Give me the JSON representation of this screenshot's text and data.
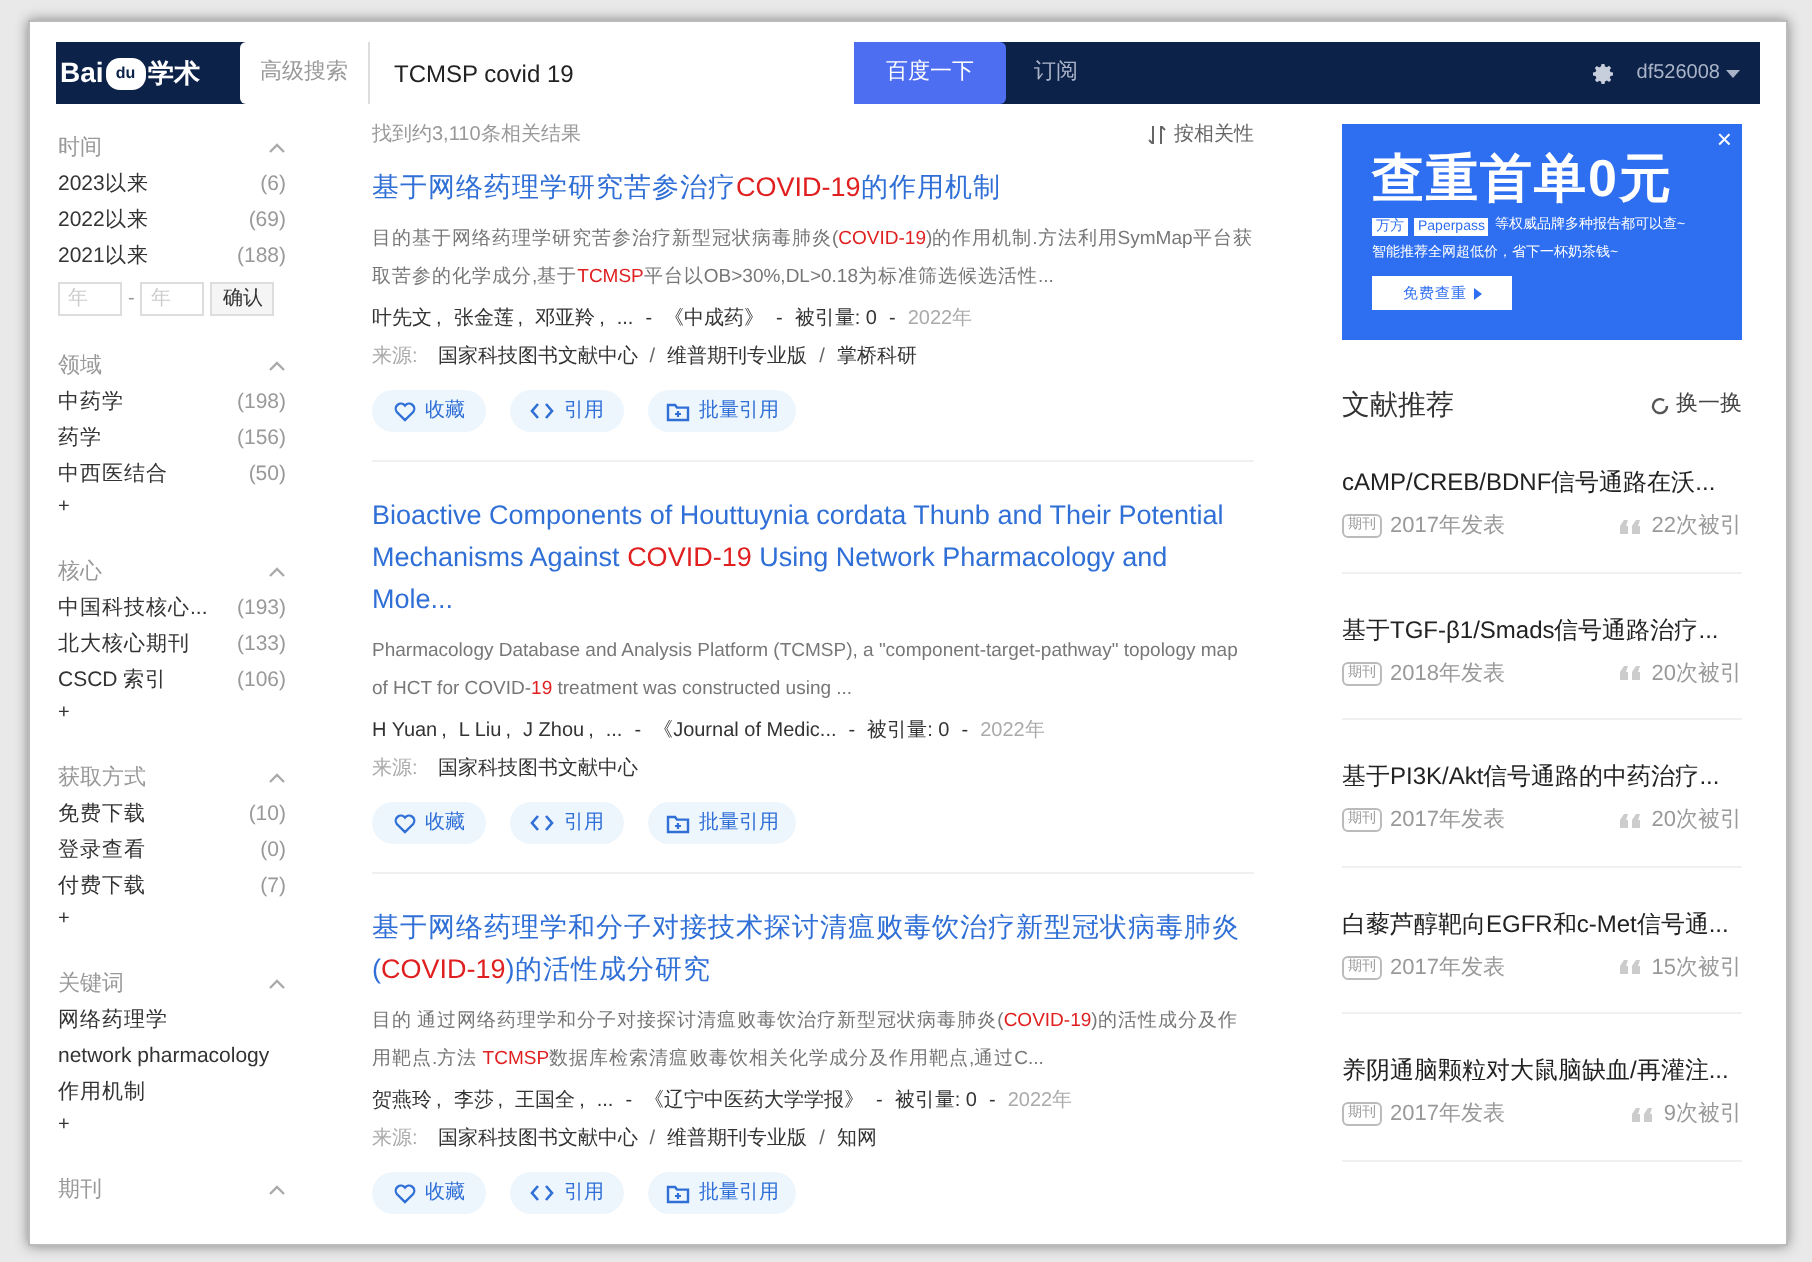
{
  "header": {
    "logo": {
      "left": "Bai",
      "mark": "du",
      "right": "学术"
    },
    "advanced_search": "高级搜索",
    "query": "TCMSP covid 19",
    "search_button": "百度一下",
    "subscribe": "订阅",
    "username": "df526008"
  },
  "sidebar": [
    {
      "title": "时间",
      "expanded": true,
      "items": [
        {
          "label": "2023以来",
          "count": "(6)"
        },
        {
          "label": "2022以来",
          "count": "(69)"
        },
        {
          "label": "2021以来",
          "count": "(188)"
        }
      ],
      "year_range": {
        "from_placeholder": "年",
        "separator": "-",
        "to_placeholder": "年",
        "confirm": "确认"
      }
    },
    {
      "title": "领域",
      "expanded": true,
      "items": [
        {
          "label": "中药学",
          "count": "(198)"
        },
        {
          "label": "药学",
          "count": "(156)"
        },
        {
          "label": "中西医结合",
          "count": "(50)"
        }
      ],
      "more": "+"
    },
    {
      "title": "核心",
      "expanded": true,
      "items": [
        {
          "label": "中国科技核心...",
          "count": "(193)"
        },
        {
          "label": "北大核心期刊",
          "count": "(133)"
        },
        {
          "label": "CSCD 索引",
          "count": "(106)"
        }
      ],
      "more": "+"
    },
    {
      "title": "获取方式",
      "expanded": true,
      "items": [
        {
          "label": "免费下载",
          "count": "(10)"
        },
        {
          "label": "登录查看",
          "count": "(0)"
        },
        {
          "label": "付费下载",
          "count": "(7)"
        }
      ],
      "more": "+"
    },
    {
      "title": "关键词",
      "expanded": true,
      "items": [
        {
          "label": "网络药理学"
        },
        {
          "label": "network pharmacology"
        },
        {
          "label": "作用机制"
        }
      ],
      "more": "+"
    },
    {
      "title": "期刊",
      "expanded": true
    }
  ],
  "results_summary": "找到约3,110条相关结果",
  "sort": "按相关性",
  "results": [
    {
      "title": [
        {
          "text": "基于网络药理学研究苦参治疗",
          "highlight": false
        },
        {
          "text": "COVID-19",
          "highlight": true
        },
        {
          "text": "的作用机制",
          "highlight": false
        }
      ],
      "snippet": [
        {
          "text": "目的基于网络药理学研究苦参治疗新型冠状病毒肺炎(",
          "highlight": false
        },
        {
          "text": "COVID-19",
          "highlight": true
        },
        {
          "text": ")的作用机制.方法利用SymMap平台获取苦参的化学成分,基于",
          "highlight": false
        },
        {
          "text": "TCMSP",
          "highlight": true
        },
        {
          "text": "平台以OB>30%,DL>0.18为标准筛选候选活性...",
          "highlight": false
        }
      ],
      "authors": [
        "叶先文",
        "张金莲",
        "邓亚羚"
      ],
      "author_sep": ",",
      "dash": "-",
      "source_sep": "/",
      "ellipsis": "...",
      "journal": "《中成药》",
      "cited": "被引量: 0",
      "year": "2022年",
      "source_label": "来源:",
      "sources": [
        "国家科技图书文献中心",
        "维普期刊专业版",
        "掌桥科研"
      ],
      "actions": [
        "收藏",
        "引用",
        "批量引用"
      ]
    },
    {
      "title": [
        {
          "text": "Bioactive Components of Houttuynia cordata Thunb and Their Potential Mechanisms Against ",
          "highlight": false
        },
        {
          "text": "COVID-19",
          "highlight": true
        },
        {
          "text": " Using Network Pharmacology and Mole...",
          "highlight": false
        }
      ],
      "snippet": [
        {
          "text": "Pharmacology Database and Analysis Platform (TCMSP), a \"component-target-pathway\" topology map of HCT for COVID-",
          "highlight": false
        },
        {
          "text": "19",
          "highlight": true
        },
        {
          "text": " treatment was constructed using ...",
          "highlight": false
        }
      ],
      "authors": [
        "H Yuan",
        "L Liu",
        "J Zhou"
      ],
      "author_sep": ",",
      "dash": "-",
      "ellipsis": "...",
      "journal": "《Journal of Medic...",
      "cited": "被引量: 0",
      "year": "2022年",
      "source_label": "来源:",
      "sources": [
        "国家科技图书文献中心"
      ],
      "actions": [
        "收藏",
        "引用",
        "批量引用"
      ]
    },
    {
      "title": [
        {
          "text": "基于网络药理学和分子对接技术探讨清瘟败毒饮治疗新型冠状病毒肺炎(",
          "highlight": false
        },
        {
          "text": "COVID-19",
          "highlight": true
        },
        {
          "text": ")的活性成分研究",
          "highlight": false
        }
      ],
      "snippet": [
        {
          "text": "目的 通过网络药理学和分子对接探讨清瘟败毒饮治疗新型冠状病毒肺炎(",
          "highlight": false
        },
        {
          "text": "COVID-19",
          "highlight": true
        },
        {
          "text": ")的活性成分及作用靶点.方法 ",
          "highlight": false
        },
        {
          "text": "TCMSP",
          "highlight": true
        },
        {
          "text": "数据库检索清瘟败毒饮相关化学成分及作用靶点,通过C...",
          "highlight": false
        }
      ],
      "authors": [
        "贺燕玲",
        "李莎",
        "王国全"
      ],
      "author_sep": ",",
      "dash": "-",
      "source_sep": "/",
      "ellipsis": "...",
      "journal": "《辽宁中医药大学学报》",
      "cited": "被引量: 0",
      "year": "2022年",
      "source_label": "来源:",
      "sources": [
        "国家科技图书文献中心",
        "维普期刊专业版",
        "知网"
      ],
      "actions": [
        "收藏",
        "引用",
        "批量引用"
      ]
    }
  ],
  "ad": {
    "headline": "查重首单0元",
    "brands": [
      "万方",
      "Paperpass"
    ],
    "line_1": "等权威品牌多种报告都可以查~",
    "line_2": "智能推荐全网超低价，省下一杯奶茶钱~",
    "button": "免费查重",
    "close": "×"
  },
  "recommendations": {
    "title": "文献推荐",
    "refresh": "换一换",
    "items": [
      {
        "title": "cAMP/CREB/BDNF信号通路在沃...",
        "tag": "期刊",
        "date": "2017年发表",
        "cited": "22次被引"
      },
      {
        "title": "基于TGF-β1/Smads信号通路治疗...",
        "tag": "期刊",
        "date": "2018年发表",
        "cited": "20次被引"
      },
      {
        "title": "基于PI3K/Akt信号通路的中药治疗...",
        "tag": "期刊",
        "date": "2017年发表",
        "cited": "20次被引"
      },
      {
        "title": "白藜芦醇靶向EGFR和c-Met信号通...",
        "tag": "期刊",
        "date": "2017年发表",
        "cited": "15次被引"
      },
      {
        "title": "养阴通脑颗粒对大鼠脑缺血/再灌注...",
        "tag": "期刊",
        "date": "2017年发表",
        "cited": "9次被引"
      }
    ]
  }
}
